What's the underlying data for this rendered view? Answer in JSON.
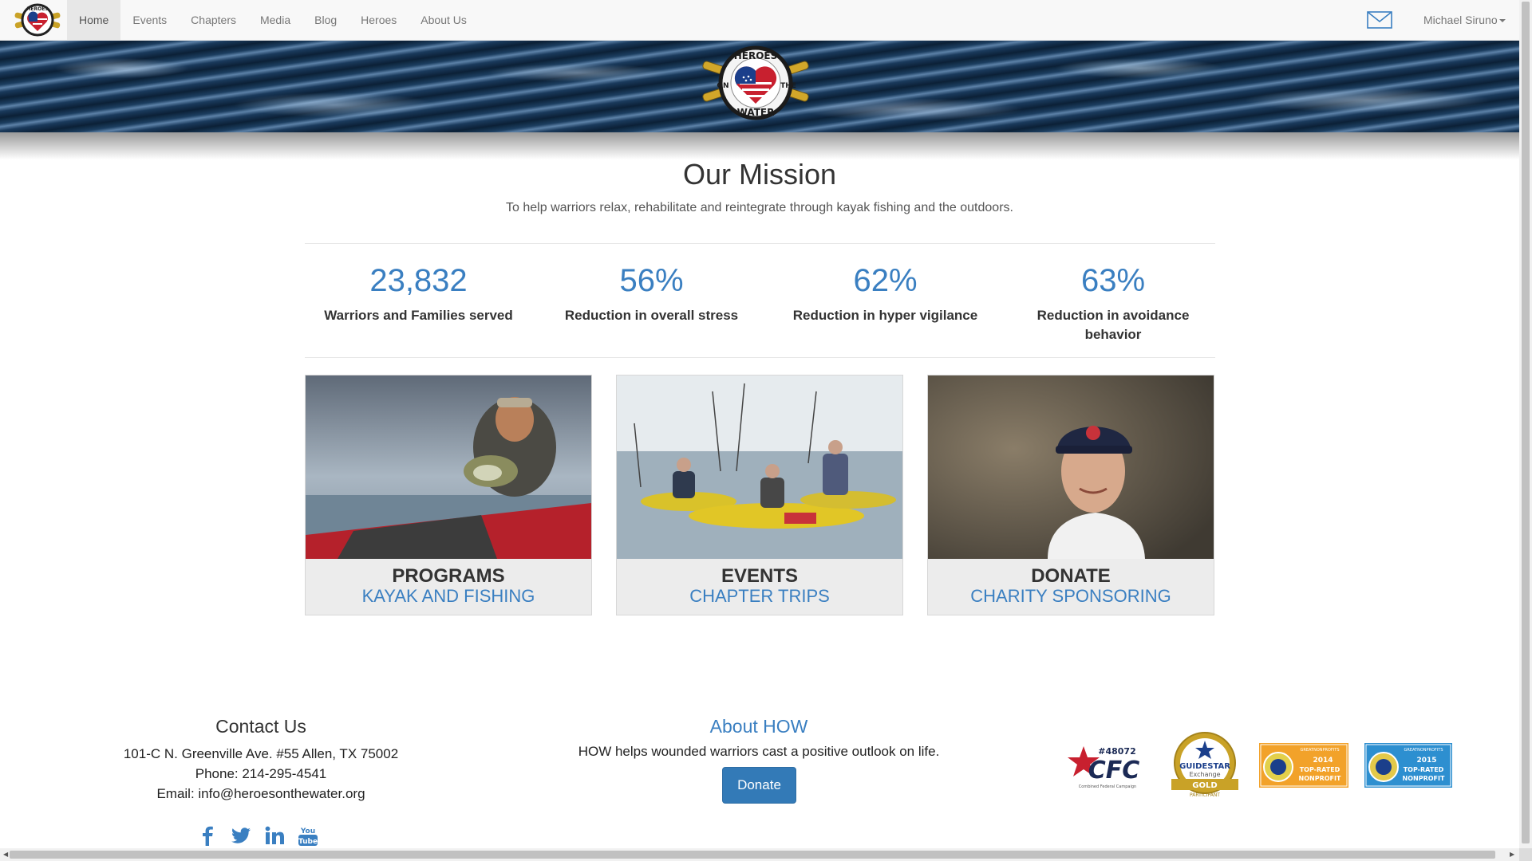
{
  "nav": {
    "items": [
      {
        "label": "Home",
        "active": true
      },
      {
        "label": "Events",
        "active": false
      },
      {
        "label": "Chapters",
        "active": false
      },
      {
        "label": "Media",
        "active": false
      },
      {
        "label": "Blog",
        "active": false
      },
      {
        "label": "Heroes",
        "active": false
      },
      {
        "label": "About Us",
        "active": false
      }
    ],
    "user_name": "Michael Siruno",
    "mail_icon": "envelope-icon"
  },
  "logo": {
    "top_text": "HEROES",
    "left_text": "ON",
    "right_text": "THE",
    "bottom_text": "WATER"
  },
  "mission": {
    "title": "Our Mission",
    "text": "To help warriors relax, rehabilitate and reintegrate through kayak fishing and the outdoors."
  },
  "stats": [
    {
      "value": "23,832",
      "label": "Warriors and Families served"
    },
    {
      "value": "56%",
      "label": "Reduction in overall stress"
    },
    {
      "value": "62%",
      "label": "Reduction in hyper vigilance"
    },
    {
      "value": "63%",
      "label": "Reduction in avoidance behavior"
    }
  ],
  "cards": [
    {
      "title": "PROGRAMS",
      "subtitle": "KAYAK AND FISHING"
    },
    {
      "title": "EVENTS",
      "subtitle": "CHAPTER TRIPS"
    },
    {
      "title": "DONATE",
      "subtitle": "CHARITY SPONSORING"
    }
  ],
  "contact": {
    "title": "Contact Us",
    "address": "101-C N. Greenville Ave. #55 Allen, TX 75002",
    "phone": "Phone: 214-295-4541",
    "email": "Email: info@heroesonthewater.org",
    "socials": [
      "facebook-icon",
      "twitter-icon",
      "linkedin-icon",
      "youtube-icon"
    ],
    "youtube_top": "You",
    "youtube_bottom": "Tube"
  },
  "about": {
    "title": "About HOW",
    "text": "HOW helps wounded warriors cast a positive outlook on life.",
    "donate_label": "Donate"
  },
  "badges": {
    "cfc_number": "#48072",
    "cfc_name": "CFC",
    "cfc_small": "Combined Federal Campaign",
    "guidestar_name": "GUIDESTAR",
    "guidestar_exchange": "Exchange",
    "guidestar_level": "GOLD",
    "guidestar_participant": "PARTICIPANT",
    "gnp_brand": "GREATNONPROFITS",
    "gnp_2014_year": "2014",
    "gnp_2014_line1": "TOP-RATED",
    "gnp_2014_line2": "NONPROFIT",
    "gnp_2015_year": "2015",
    "gnp_2015_line1": "TOP-RATED",
    "gnp_2015_line2": "NONPROFIT"
  },
  "colors": {
    "accent": "#3a7fc1",
    "donate_button": "#337ab7",
    "navbar_bg": "#f8f8f8"
  }
}
